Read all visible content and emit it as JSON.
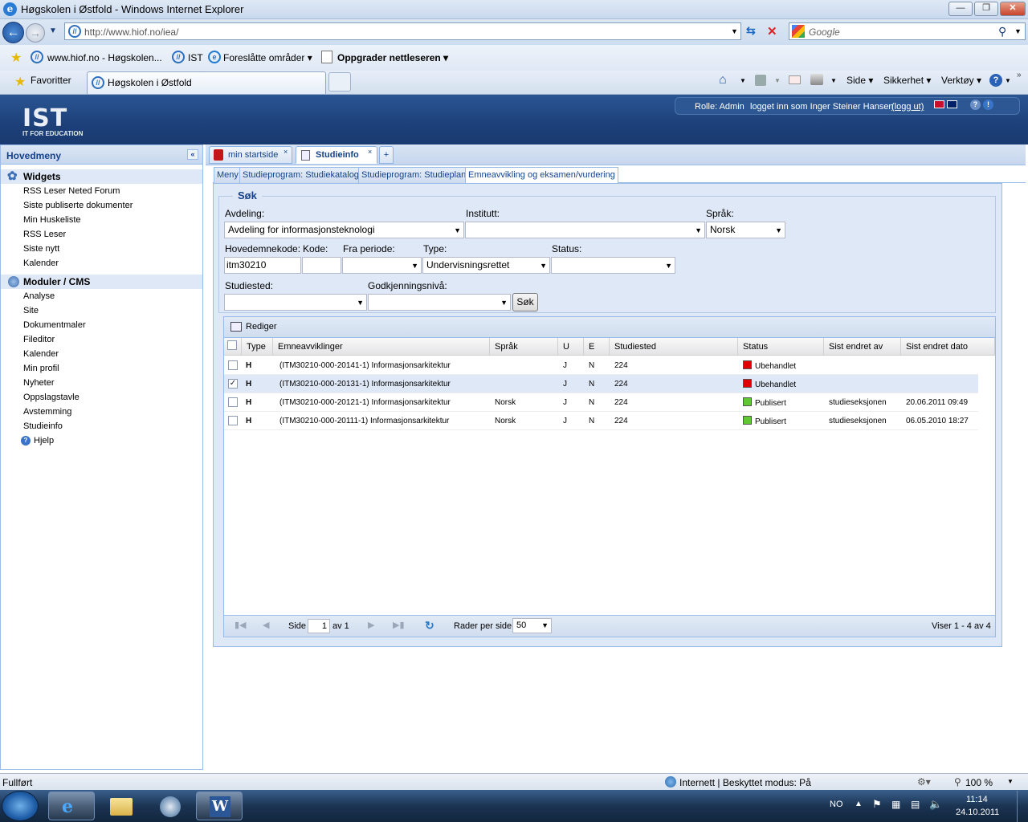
{
  "window": {
    "title": "Høgskolen i Østfold - Windows Internet Explorer",
    "url_host": "http://www.hiof.no",
    "url_path": "/iea/",
    "search_placeholder": "Google"
  },
  "favorites_bar": {
    "items": [
      "www.hiof.no - Høgskolen...",
      "IST",
      "Foreslåtte områder ▾",
      "Oppgrader nettleseren ▾"
    ],
    "favorites_label": "Favoritter",
    "tab_title": "Høgskolen i Østfold",
    "command_items": [
      "Side ▾",
      "Sikkerhet ▾",
      "Verktøy ▾"
    ]
  },
  "app": {
    "logo_big": "IST",
    "logo_small": "IT FOR EDUCATION",
    "role": "Rolle: Admin",
    "logged_in": "logget inn som Inger Steiner Hansen",
    "logout": "(logg ut)"
  },
  "sidebar": {
    "title": "Hovedmeny",
    "groups": [
      {
        "label": "Widgets",
        "items": [
          "RSS Leser Neted Forum",
          "Siste publiserte dokumenter",
          "Min Huskeliste",
          "RSS Leser",
          "Siste nytt",
          "Kalender"
        ]
      },
      {
        "label": "Moduler / CMS",
        "items": [
          "Analyse",
          "Site",
          "Dokumentmaler",
          "Fileditor",
          "Kalender",
          "Min profil",
          "Nyheter",
          "Oppslagstavle",
          "Avstemming",
          "Studieinfo"
        ]
      }
    ],
    "help": "Hjelp"
  },
  "tabs": [
    "min startside",
    "Studieinfo",
    "+"
  ],
  "subtabs": [
    "Meny",
    "Studieprogram: Studiekatalog",
    "Studieprogram: Studieplan",
    "Emneavvikling og eksamen/vurdering"
  ],
  "search": {
    "legend": "Søk",
    "avdeling_label": "Avdeling:",
    "avdeling_value": "Avdeling for informasjonsteknologi",
    "institutt_label": "Institutt:",
    "institutt_value": "",
    "sprak_label": "Språk:",
    "sprak_value": "Norsk",
    "hovedemnekode_label": "Hovedemnekode:",
    "hovedemnekode_value": "itm30210",
    "kode_label": "Kode:",
    "kode_value": "",
    "fra_periode_label": "Fra periode:",
    "fra_periode_value": "",
    "type_label": "Type:",
    "type_value": "Undervisningsrettet",
    "status_label": "Status:",
    "status_value": "",
    "studiested_label": "Studiested:",
    "studiested_value": "",
    "godkjenning_label": "Godkjenningsnivå:",
    "godkjenning_value": "",
    "button": "Søk"
  },
  "grid": {
    "toolbar_edit": "Rediger",
    "columns": [
      "Type",
      "Emneavviklinger",
      "Språk",
      "U",
      "E",
      "Studiested",
      "Status",
      "Sist endret av",
      "Sist endret dato"
    ],
    "rows": [
      {
        "checked": false,
        "type": "H",
        "name": "(ITM30210-000-20141-1) Informasjonsarkitektur",
        "sprak": "",
        "u": "J",
        "e": "N",
        "studiested": "224",
        "status": "Ubehandlet",
        "status_color": "#e00000",
        "endret_av": "",
        "endret_dato": ""
      },
      {
        "checked": true,
        "type": "H",
        "name": "(ITM30210-000-20131-1) Informasjonsarkitektur",
        "sprak": "",
        "u": "J",
        "e": "N",
        "studiested": "224",
        "status": "Ubehandlet",
        "status_color": "#e00000",
        "endret_av": "",
        "endret_dato": ""
      },
      {
        "checked": false,
        "type": "H",
        "name": "(ITM30210-000-20121-1) Informasjonsarkitektur",
        "sprak": "Norsk",
        "u": "J",
        "e": "N",
        "studiested": "224",
        "status": "Publisert",
        "status_color": "#5fc82e",
        "endret_av": "studieseksjonen",
        "endret_dato": "20.06.2011 09:49"
      },
      {
        "checked": false,
        "type": "H",
        "name": "(ITM30210-000-20111-1) Informasjonsarkitektur",
        "sprak": "Norsk",
        "u": "J",
        "e": "N",
        "studiested": "224",
        "status": "Publisert",
        "status_color": "#5fc82e",
        "endret_av": "studieseksjonen",
        "endret_dato": "06.05.2010 18:27"
      }
    ],
    "pager": {
      "side_label": "Side",
      "page": "1",
      "of_label": "av 1",
      "rows_label": "Rader per side",
      "rows_value": "50",
      "summary": "Viser 1 - 4 av 4"
    }
  },
  "statusbar": {
    "left": "Fullført",
    "zone": "Internett | Beskyttet modus: På",
    "zoom": "100 %"
  },
  "taskbar": {
    "lang": "NO",
    "time": "11:14",
    "date": "24.10.2011"
  }
}
